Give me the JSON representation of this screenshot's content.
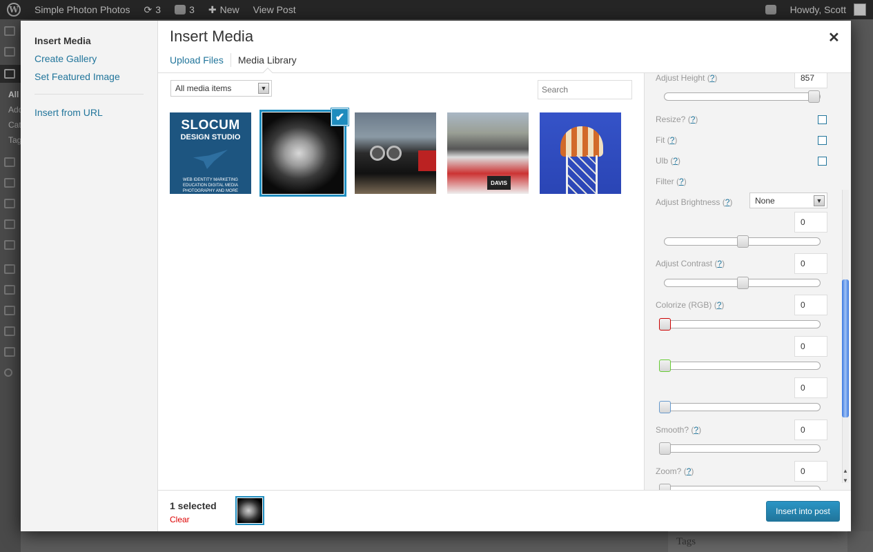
{
  "adminbar": {
    "site_name": "Simple Photon Photos",
    "updates_count": "3",
    "comments_count": "3",
    "new_label": "New",
    "view_post_label": "View Post",
    "howdy": "Howdy, Scott"
  },
  "background": {
    "sidebar_all": "All",
    "sidebar_add": "Add",
    "sidebar_cat": "Cat",
    "sidebar_tag": "Tag",
    "tags_box": "Tags"
  },
  "menu": {
    "items": [
      {
        "label": "Insert Media",
        "active": true
      },
      {
        "label": "Create Gallery"
      },
      {
        "label": "Set Featured Image"
      },
      {
        "label": "Insert from URL"
      }
    ]
  },
  "frame": {
    "title": "Insert Media",
    "close_symbol": "✕",
    "tabs": [
      "Upload Files",
      "Media Library"
    ],
    "active_tab": "Media Library"
  },
  "toolbar_top": {
    "filter_value": "All media items",
    "search_placeholder": "Search"
  },
  "attachments": [
    {
      "name": "Slocum Design Studio logo",
      "text1": "SLOCUM",
      "text2": "DESIGN STUDIO",
      "text3": "WEB   IDENTITY   MARKETING",
      "text4": "EDUCATION   DIGITAL MEDIA",
      "text5": "PHOTOGRAPHY   AND MORE"
    },
    {
      "name": "portrait",
      "selected": true
    },
    {
      "name": "classic car"
    },
    {
      "name": "drag racing car",
      "sign": "DAVIS"
    },
    {
      "name": "water tower"
    }
  ],
  "settings": {
    "adjust_height": {
      "label": "Adjust Height",
      "help": "?",
      "value": "857",
      "slider": 1.0
    },
    "resize": {
      "label": "Resize?",
      "help": "?"
    },
    "fit": {
      "label": "Fit",
      "help": "?"
    },
    "ulb": {
      "label": "Ulb",
      "help": "?"
    },
    "filter": {
      "label": "Filter",
      "help": "?",
      "value": "None"
    },
    "brightness": {
      "label": "Adjust Brightness",
      "help": "?",
      "value": "0",
      "slider": 0.5
    },
    "contrast": {
      "label": "Adjust Contrast",
      "help": "?",
      "value": "0",
      "slider": 0.5
    },
    "colorize": {
      "label": "Colorize (RGB)",
      "help": "?",
      "r": "0",
      "g": "0",
      "b": "0"
    },
    "smooth": {
      "label": "Smooth?",
      "help": "?",
      "value": "0"
    },
    "zoom": {
      "label": "Zoom?",
      "help": "?",
      "value": "0"
    }
  },
  "footer": {
    "selected_count": "1 selected",
    "clear_label": "Clear",
    "insert_label": "Insert into post"
  },
  "colors": {
    "accent": "#21759b",
    "selected_outline": "#1e8cbe",
    "clear": "#dd0000"
  }
}
